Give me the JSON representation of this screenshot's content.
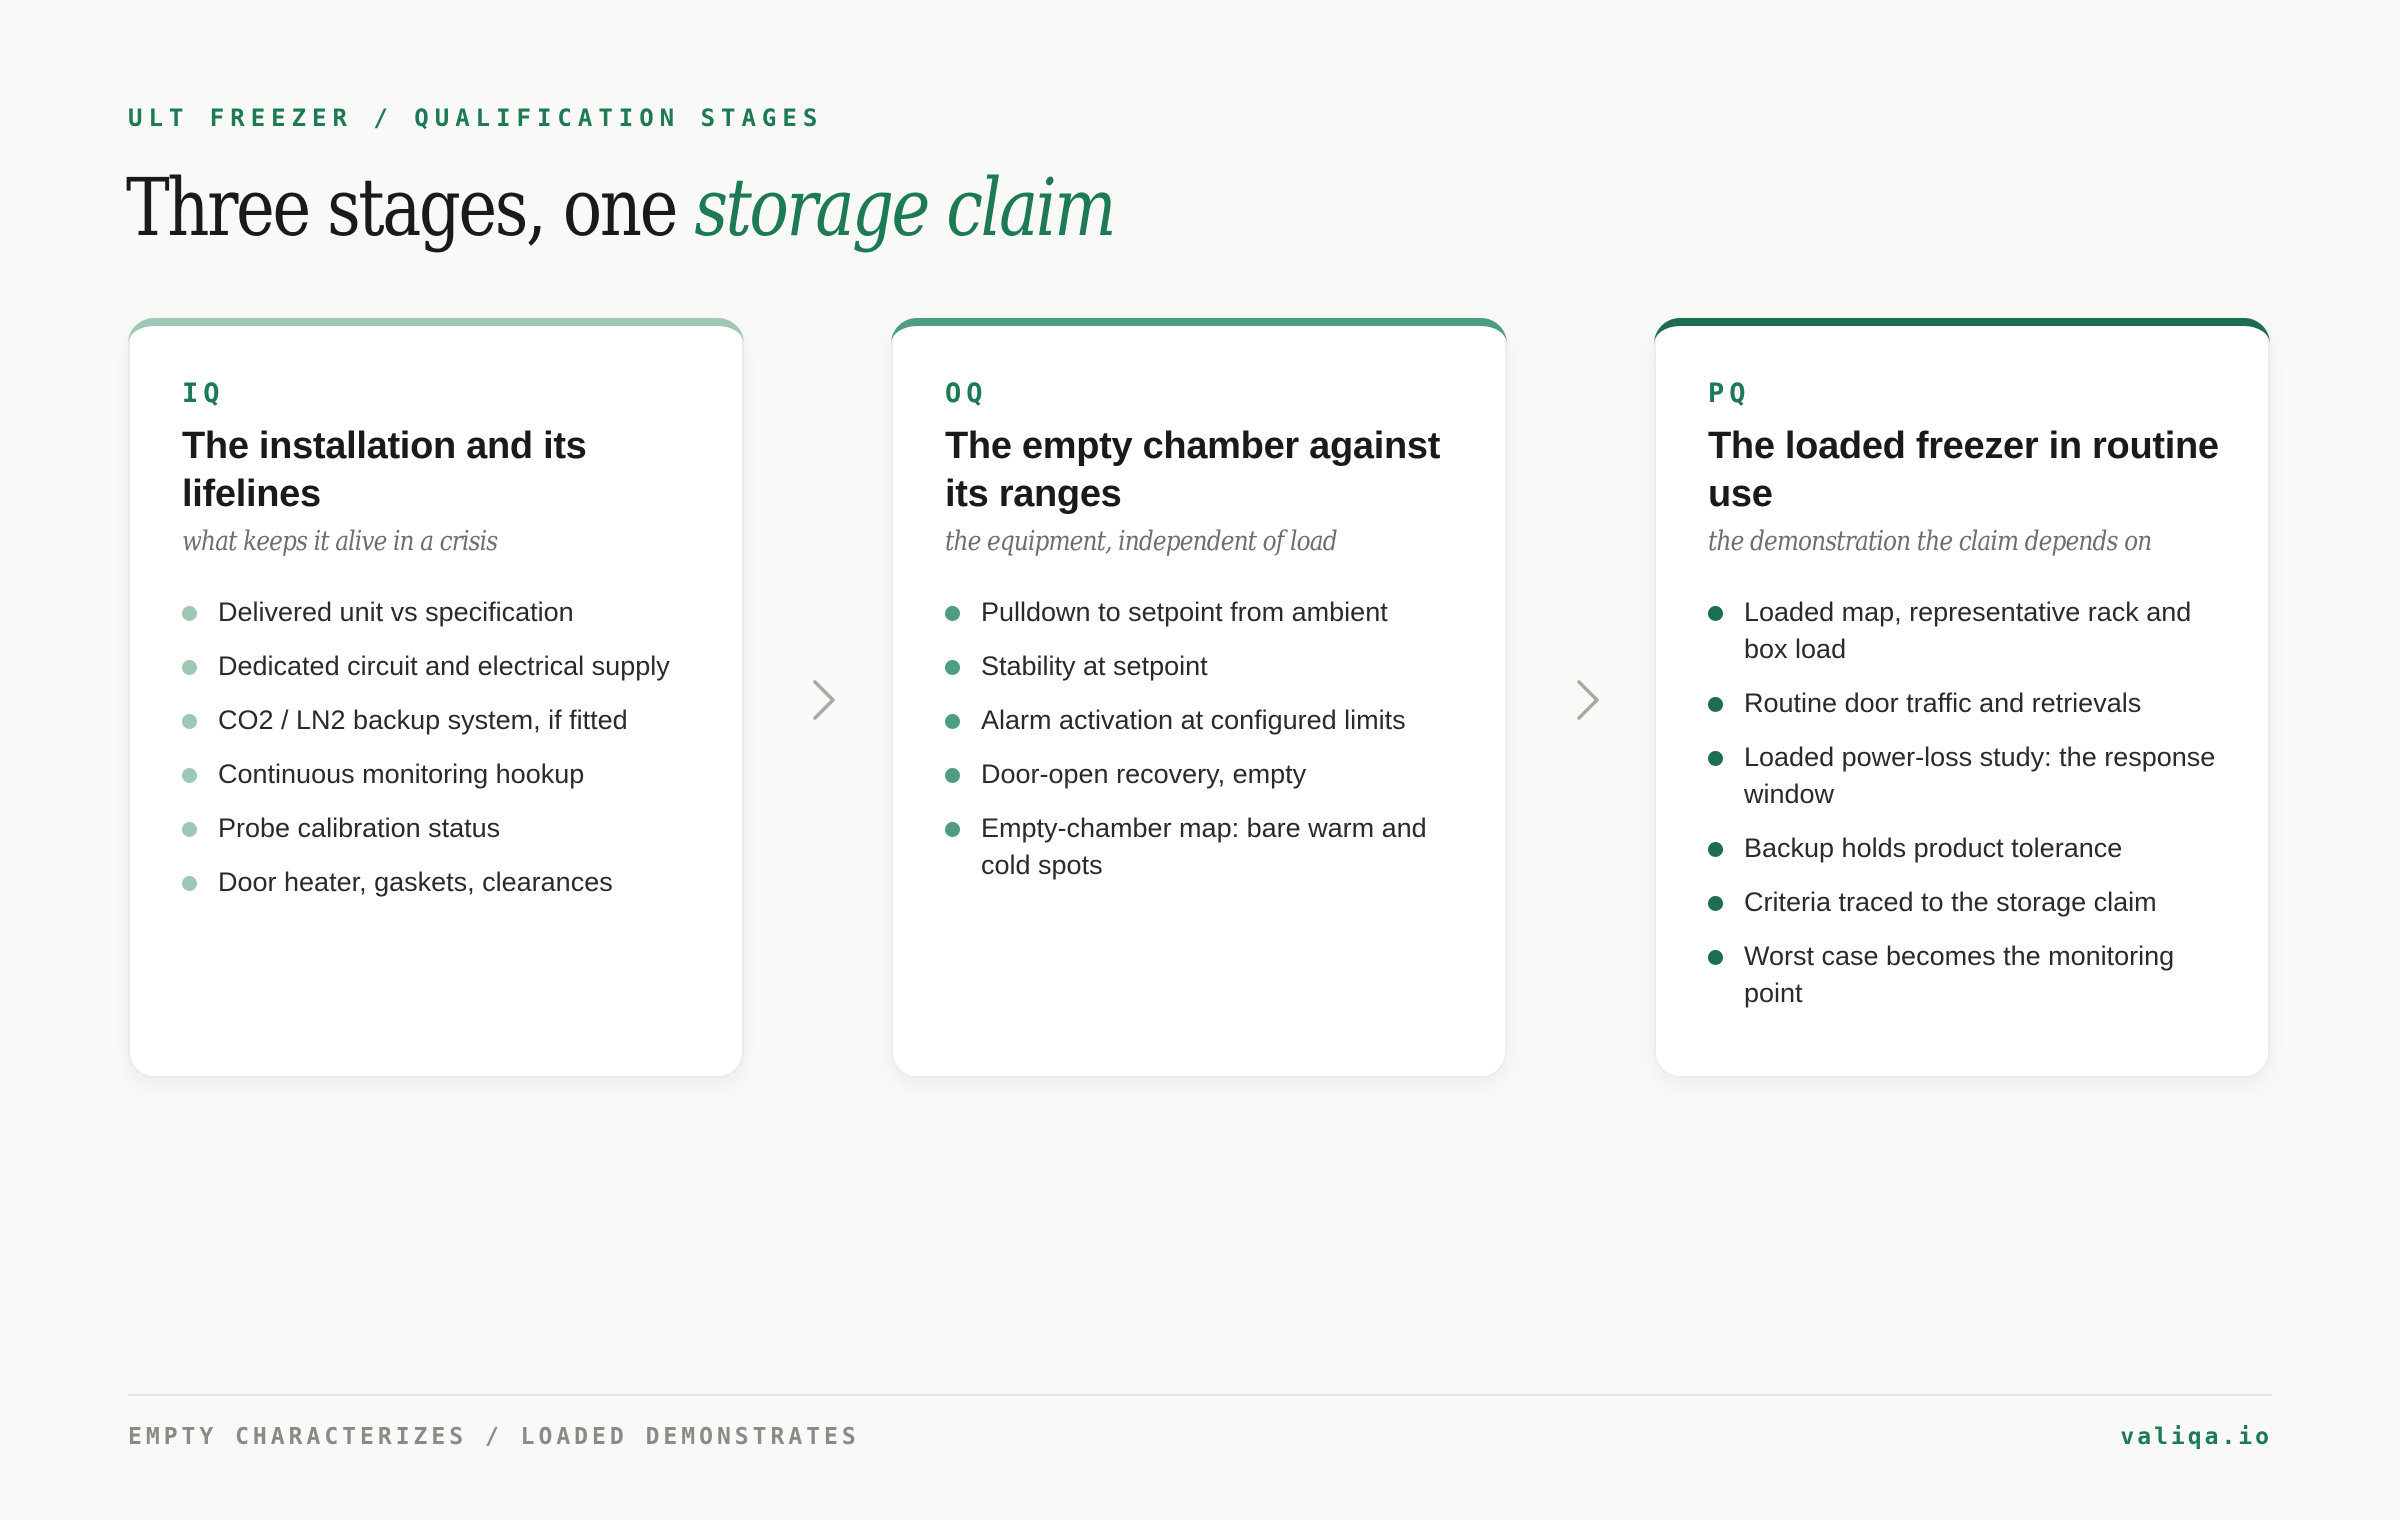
{
  "header": {
    "eyebrow": "ULT FREEZER / QUALIFICATION STAGES",
    "title_main": "Three stages, one ",
    "title_accent": "storage claim"
  },
  "colors": {
    "accent": "#1c7a55",
    "iq_accent": "#9ec7b4",
    "oq_accent": "#4f9d7f",
    "pq_accent": "#1c6e4f"
  },
  "stages": [
    {
      "tag": "IQ",
      "title": "The installation and its lifelines",
      "subtitle": "what keeps it alive in a crisis",
      "items": [
        "Delivered unit vs specification",
        "Dedicated circuit and electrical supply",
        "CO2 / LN2 backup system, if fitted",
        "Continuous monitoring hookup",
        "Probe calibration status",
        "Door heater, gaskets, clearances"
      ]
    },
    {
      "tag": "OQ",
      "title": "The empty chamber against its ranges",
      "subtitle": "the equipment, independent of load",
      "items": [
        "Pulldown to setpoint from ambient",
        "Stability at setpoint",
        "Alarm activation at configured limits",
        "Door-open recovery, empty",
        "Empty-chamber map: bare warm and cold spots"
      ]
    },
    {
      "tag": "PQ",
      "title": "The loaded freezer in routine use",
      "subtitle": "the demonstration the claim depends on",
      "items": [
        "Loaded map, representative rack and box load",
        "Routine door traffic and retrievals",
        "Loaded power-loss study: the response window",
        "Backup holds product tolerance",
        "Criteria traced to the storage claim",
        "Worst case becomes the monitoring point"
      ]
    }
  ],
  "footer": {
    "left": "EMPTY CHARACTERIZES / LOADED DEMONSTRATES",
    "right": "valiqa.io"
  }
}
